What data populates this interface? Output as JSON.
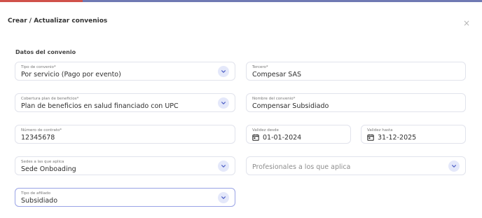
{
  "modal": {
    "title": "Crear / Actualizar convenios",
    "close_icon": "×",
    "section_title": "Datos del convenio"
  },
  "fields": {
    "tipo_convenio": {
      "label": "Tipo de convenio*",
      "value": "Por servicio (Pago por evento)"
    },
    "tercero": {
      "label": "Tercero*",
      "value": "Compesar  SAS"
    },
    "cobertura": {
      "label": "Cobertura plan de beneficios*",
      "value": "Plan de beneficios en salud financiado con UPC"
    },
    "nombre_convenio": {
      "label": "Nombre del convenio*",
      "value": "Compensar Subsidiado"
    },
    "numero_contrato": {
      "label": "Número de contrato*",
      "value": "12345678"
    },
    "validez_desde": {
      "label": "Validez desde",
      "value": "01-01-2024"
    },
    "validez_hasta": {
      "label": "Validez hasta",
      "value": "31-12-2025"
    },
    "sedes": {
      "label": "Sedes a las que aplica",
      "value": "Sede Onboading"
    },
    "profesionales": {
      "placeholder": "Profesionales a los que aplica"
    },
    "tipo_afiliado": {
      "label": "Tipo de afiliado",
      "value": "Subsidiado"
    }
  },
  "icons": {
    "chevron": "chevron-down-icon",
    "calendar": "calendar-icon",
    "close": "close-icon"
  },
  "colors": {
    "accent_border": "#9aa4e6",
    "chevron_bg": "#e4e8fa",
    "chevron_fg": "#4a5cc4",
    "topbar": "#6f79b3",
    "topbar_red": "#d0514a"
  }
}
